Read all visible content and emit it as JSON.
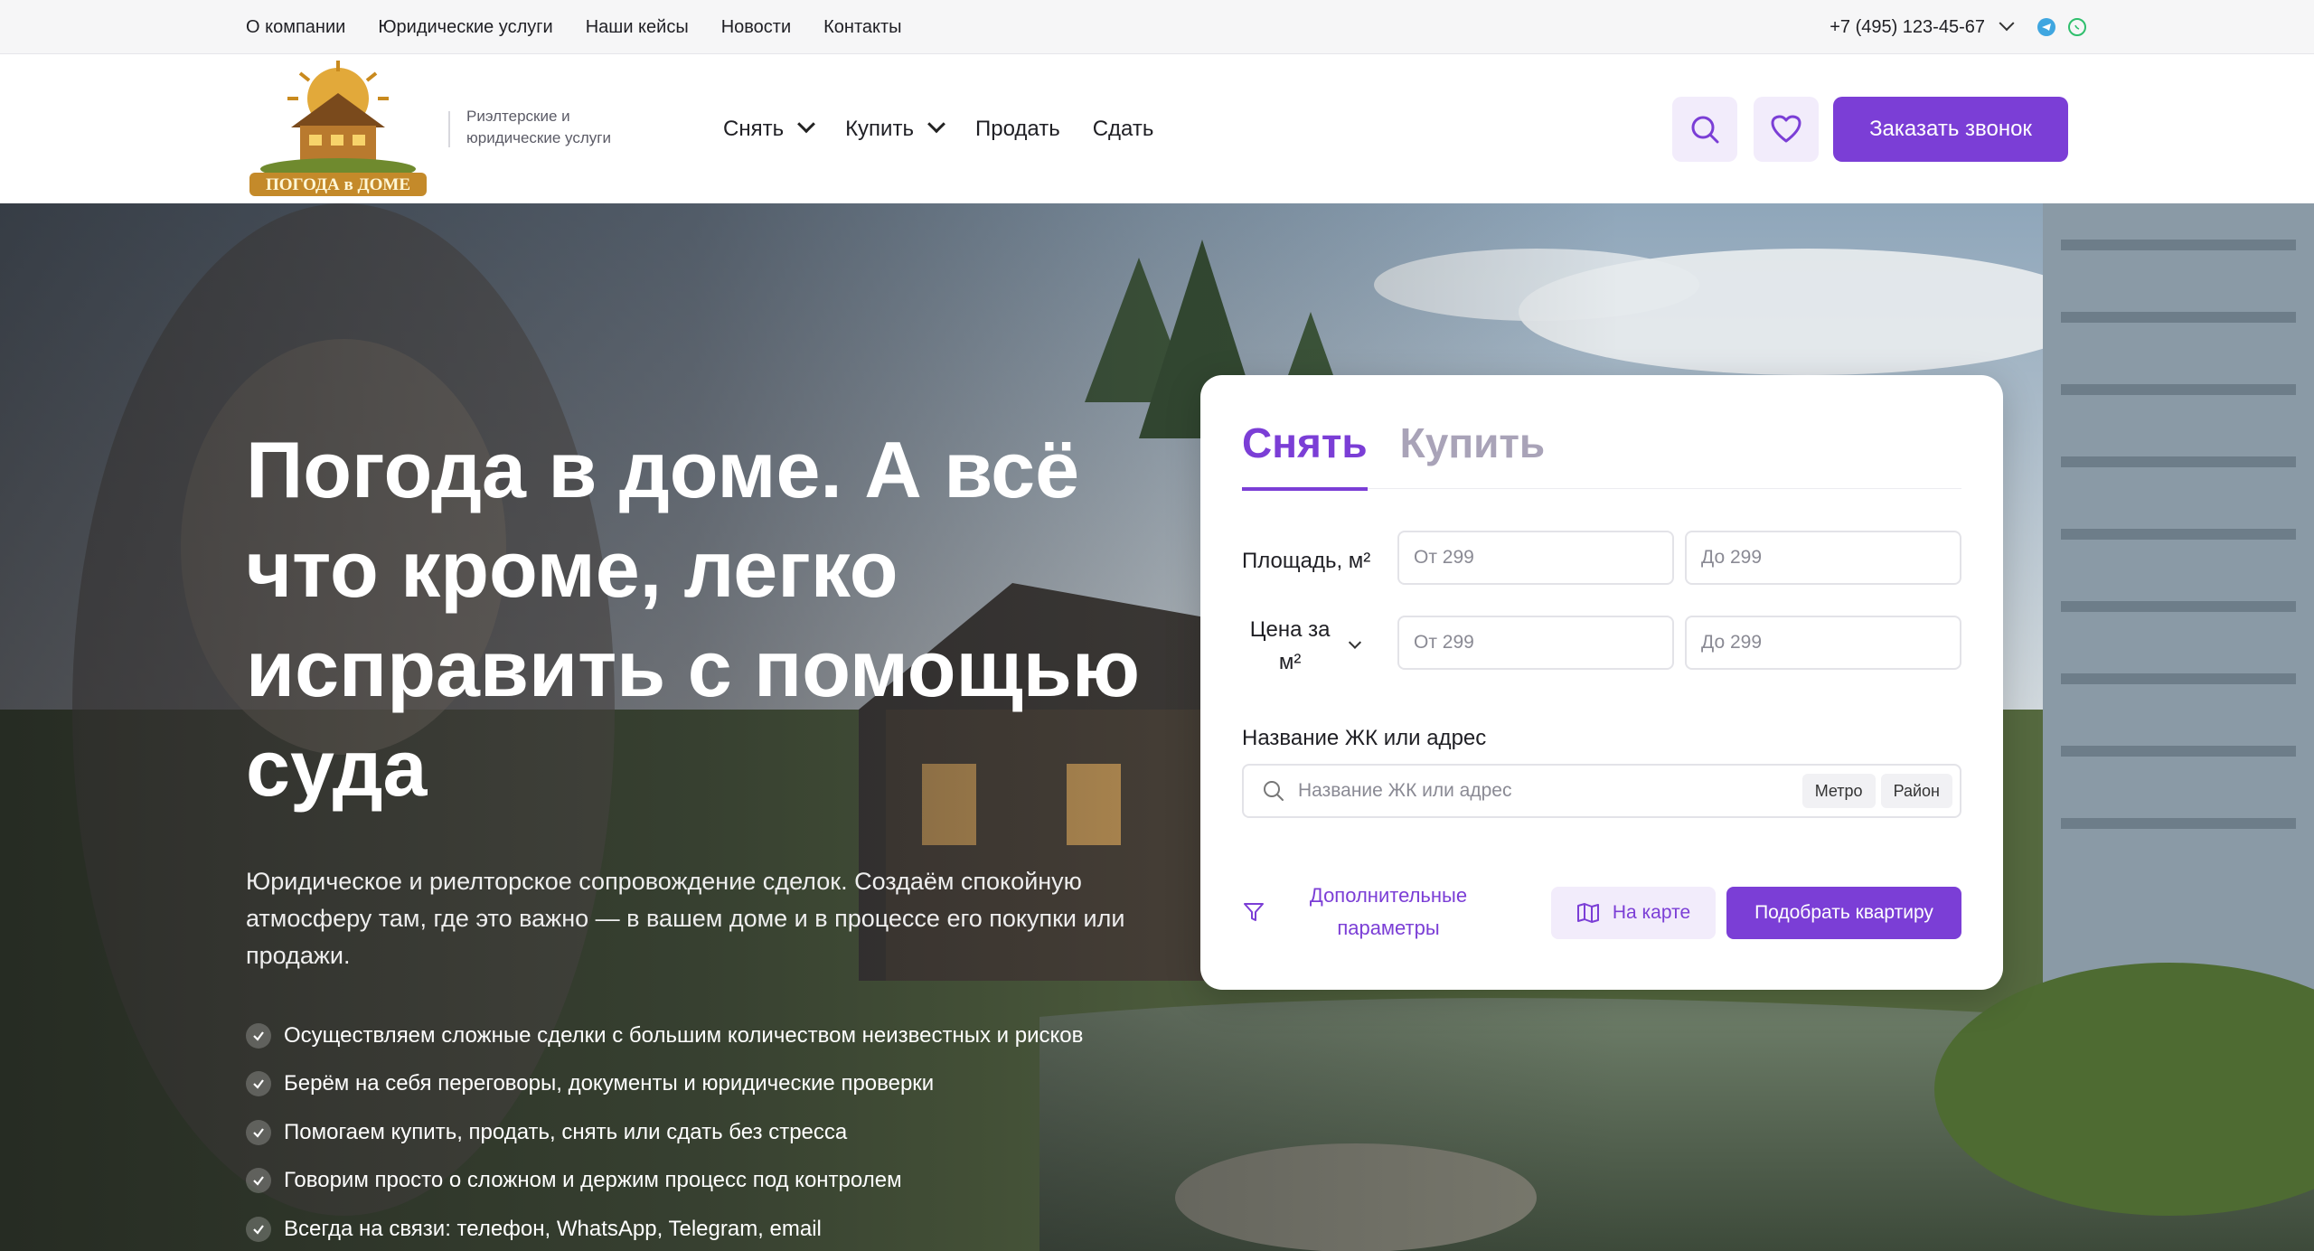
{
  "topbar": {
    "links": [
      "О компании",
      "Юридические услуги",
      "Наши кейсы",
      "Новости",
      "Контакты"
    ],
    "phone": "+7 (495) 123-45-67"
  },
  "header": {
    "logo_text": "ПОГОДА в ДОМЕ",
    "tagline": "Риэлтерские и юридические услуги",
    "nav": [
      "Снять",
      "Купить",
      "Продать",
      "Сдать"
    ],
    "cta": "Заказать звонок"
  },
  "hero": {
    "title": "Погода в доме. А всё что кроме, легко исправить с помощью суда",
    "subtitle": "Юридическое и риелторское сопровождение сделок. Создаём спокойную атмосферу там, где это важно — в вашем доме и в процессе его покупки или продажи.",
    "bullets": [
      "Осуществляем сложные сделки с большим количеством неизвестных и рисков",
      "Берём на себя переговоры, документы и юридические проверки",
      "Помогаем купить, продать, снять или сдать без стресса",
      "Говорим просто о сложном и держим процесс под контролем",
      "Всегда на связи: телефон, WhatsApp, Telegram, email"
    ]
  },
  "search": {
    "tabs": [
      "Снять",
      "Купить"
    ],
    "active_tab": "Снять",
    "area_label": "Площадь, м²",
    "area_from": "От 299",
    "area_to": "До 299",
    "price_label": "Цена за м²",
    "price_from": "От 299",
    "price_to": "До 299",
    "address_label": "Название ЖК или адрес",
    "address_placeholder": "Название ЖК или адрес",
    "chips": [
      "Метро",
      "Район"
    ],
    "more_params": "Дополнительные параметры",
    "map_button": "На карте",
    "submit": "Подобрать квартиру"
  },
  "colors": {
    "accent": "#7b3ed6",
    "accent_soft": "#f2ecfb"
  }
}
